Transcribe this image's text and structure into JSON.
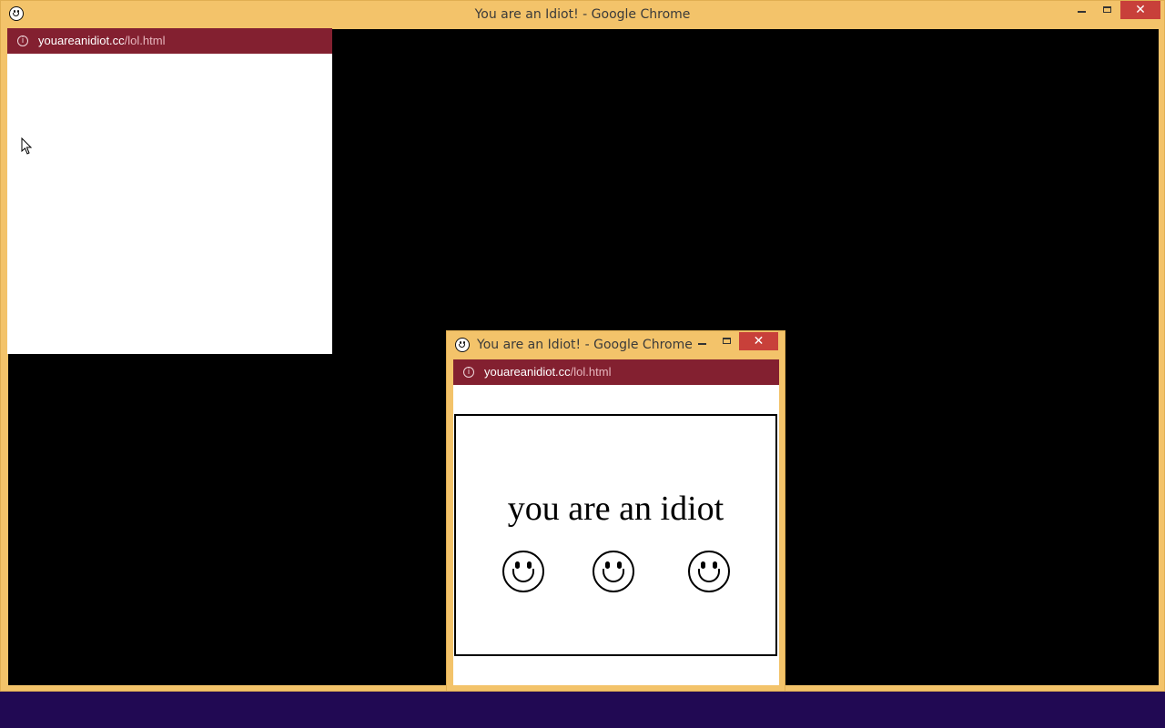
{
  "main_window": {
    "title": "You are an Idiot! - Google Chrome",
    "icon": "smiley-face-icon",
    "controls": {
      "minimize": "minimize-icon",
      "maximize": "maximize-icon",
      "close": "close-icon"
    }
  },
  "popup_small": {
    "url_host": "youareanidiot.cc",
    "url_path": "/lol.html",
    "info_icon": "i"
  },
  "popup_large": {
    "title": "You are an Idiot! - Google Chrome",
    "url_host": "youareanidiot.cc",
    "url_path": "/lol.html",
    "info_icon": "i",
    "content": {
      "headline": "you are an idiot",
      "smileys": [
        "smiley-face-icon",
        "smiley-face-icon",
        "smiley-face-icon"
      ]
    }
  },
  "colors": {
    "window_frame": "#f3c36a",
    "url_bar": "#832030",
    "close_button": "#c8403a",
    "taskbar": "#210953",
    "desktop": "#000000"
  }
}
